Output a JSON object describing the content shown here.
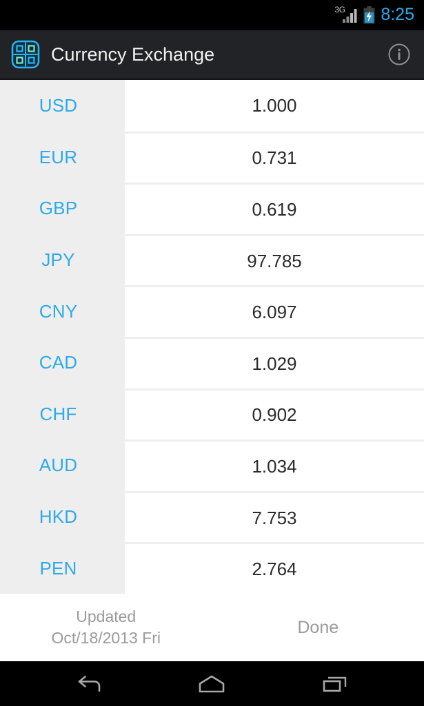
{
  "status_bar": {
    "network_type": "3G",
    "signal_icon": "signal-bars-icon",
    "battery_icon": "battery-charging-icon",
    "clock": "8:25",
    "clock_color": "#2eaae8"
  },
  "action_bar": {
    "app_icon": "currency-exchange-app-icon",
    "title": "Currency Exchange",
    "info_icon": "info-icon",
    "background_color": "#222326"
  },
  "theme": {
    "accent_blue": "#2eaae8",
    "row_bg": "#ffffff",
    "code_col_bg": "#eeeeee",
    "value_text": "#2b2b2b",
    "muted_text": "#9a9a9a"
  },
  "rates": {
    "base": "USD",
    "rows": [
      {
        "code": "USD",
        "value": "1.000"
      },
      {
        "code": "EUR",
        "value": "0.731"
      },
      {
        "code": "GBP",
        "value": "0.619"
      },
      {
        "code": "JPY",
        "value": "97.785"
      },
      {
        "code": "CNY",
        "value": "6.097"
      },
      {
        "code": "CAD",
        "value": "1.029"
      },
      {
        "code": "CHF",
        "value": "0.902"
      },
      {
        "code": "AUD",
        "value": "1.034"
      },
      {
        "code": "HKD",
        "value": "7.753"
      },
      {
        "code": "PEN",
        "value": "2.764"
      }
    ]
  },
  "footer": {
    "updated_label": "Updated",
    "updated_date": "Oct/18/2013 Fri",
    "done_label": "Done"
  },
  "nav_bar": {
    "back_icon": "back-arrow-icon",
    "home_icon": "home-icon",
    "recents_icon": "recent-apps-icon"
  }
}
